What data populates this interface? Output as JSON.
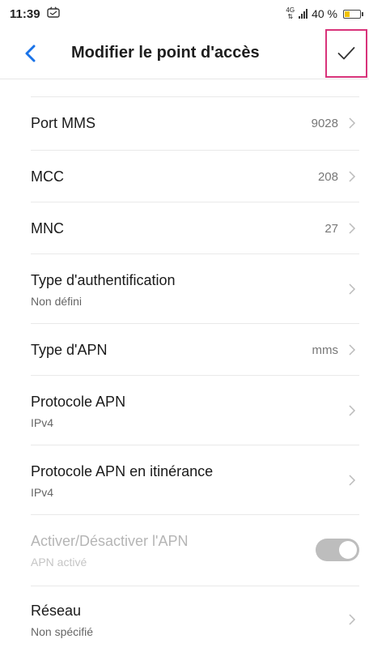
{
  "status_bar": {
    "time": "11:39",
    "network_type": "4G",
    "battery_percent": "40 %",
    "battery_level": 0.4
  },
  "header": {
    "title": "Modifier le point d'accès",
    "back_icon": "chevron-left-icon",
    "confirm_icon": "checkmark-icon",
    "accent_color": "#1a73e8"
  },
  "settings": {
    "port_mms": {
      "label": "Port MMS",
      "value": "9028"
    },
    "mcc": {
      "label": "MCC",
      "value": "208"
    },
    "mnc": {
      "label": "MNC",
      "value": "27"
    },
    "auth_type": {
      "label": "Type d'authentification",
      "sub": "Non défini"
    },
    "apn_type": {
      "label": "Type d'APN",
      "value": "mms"
    },
    "apn_protocol": {
      "label": "Protocole APN",
      "sub": "IPv4"
    },
    "apn_roaming_protocol": {
      "label": "Protocole APN en itinérance",
      "sub": "IPv4"
    },
    "apn_toggle": {
      "label": "Activer/Désactiver l'APN",
      "sub": "APN activé",
      "enabled": true,
      "disabled_state": true
    },
    "network": {
      "label": "Réseau",
      "sub": "Non spécifié"
    }
  }
}
